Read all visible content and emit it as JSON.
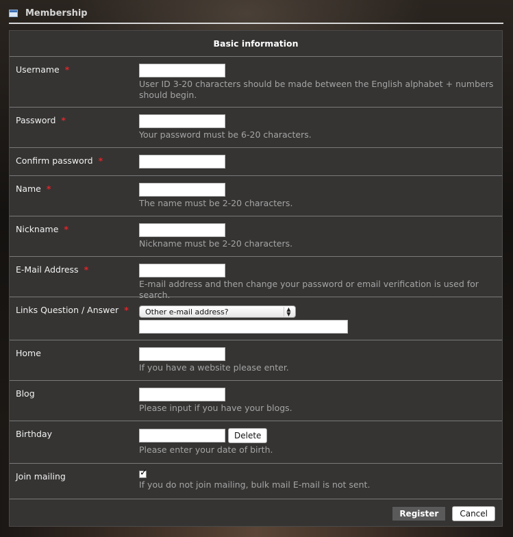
{
  "window": {
    "title": "Membership"
  },
  "form": {
    "section_title": "Basic information",
    "required_marker": "*",
    "fields": {
      "username": {
        "label": "Username",
        "value": "",
        "hint": "User ID 3-20 characters should be made between the English alphabet + numbers should begin."
      },
      "password": {
        "label": "Password",
        "value": "",
        "hint": "Your password must be 6-20 characters."
      },
      "confirm_password": {
        "label": "Confirm password",
        "value": ""
      },
      "name": {
        "label": "Name",
        "value": "",
        "hint": "The name must be 2-20 characters."
      },
      "nickname": {
        "label": "Nickname",
        "value": "",
        "hint": "Nickname must be 2-20 characters."
      },
      "email": {
        "label": "E-Mail Address",
        "value": "",
        "hint": "E-mail address and then change your password or email verification is used for search."
      },
      "links_question": {
        "label": "Links Question / Answer",
        "selected": "Other e-mail address?",
        "answer": ""
      },
      "home": {
        "label": "Home",
        "value": "",
        "hint": "If you have a website please enter."
      },
      "blog": {
        "label": "Blog",
        "value": "",
        "hint": "Please input if you have your blogs."
      },
      "birthday": {
        "label": "Birthday",
        "value": "",
        "delete_label": "Delete",
        "hint": "Please enter your date of birth."
      },
      "join_mailing": {
        "label": "Join mailing",
        "checked": true,
        "hint": "If you do not join mailing, bulk mail E-mail is not sent."
      }
    },
    "buttons": {
      "register": "Register",
      "cancel": "Cancel"
    }
  },
  "colors": {
    "panel": "#353433",
    "required": "#e0252a",
    "hint": "#a5a5a5"
  }
}
